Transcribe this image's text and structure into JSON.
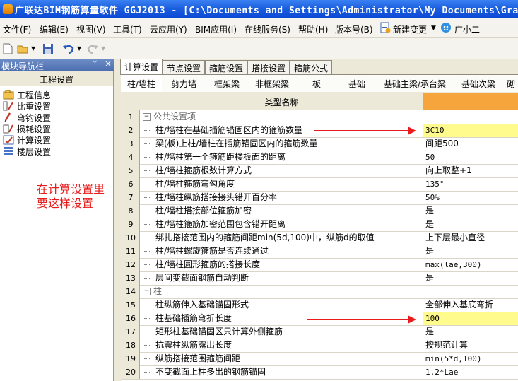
{
  "window": {
    "title": "广联达BIM钢筋算量软件 GGJ2013 - [C:\\Documents and Settings\\Administrator\\My Documents\\GrandS"
  },
  "menu": [
    {
      "label": "文件(F)"
    },
    {
      "label": "编辑(E)"
    },
    {
      "label": "视图(V)"
    },
    {
      "label": "工具(T)"
    },
    {
      "label": "云应用(Y)"
    },
    {
      "label": "BIM应用(I)"
    },
    {
      "label": "在线服务(S)"
    },
    {
      "label": "帮助(H)"
    },
    {
      "label": "版本号(B)"
    },
    {
      "label": "新建变更"
    },
    {
      "label": "广小二"
    }
  ],
  "nav": {
    "title": "模块导航栏",
    "section": "工程设置",
    "items": [
      {
        "label": "工程信息"
      },
      {
        "label": "比重设置"
      },
      {
        "label": "弯钩设置"
      },
      {
        "label": "损耗设置"
      },
      {
        "label": "计算设置"
      },
      {
        "label": "楼层设置"
      }
    ]
  },
  "annotation": {
    "line1": "在计算设置里",
    "line2": "要这样设置"
  },
  "tabs": [
    {
      "label": "计算设置"
    },
    {
      "label": "节点设置"
    },
    {
      "label": "箍筋设置"
    },
    {
      "label": "搭接设置"
    },
    {
      "label": "箍筋公式"
    }
  ],
  "subtabs": [
    {
      "label": "柱/墙柱"
    },
    {
      "label": "剪力墙"
    },
    {
      "label": "框架梁"
    },
    {
      "label": "非框架梁"
    },
    {
      "label": "板"
    },
    {
      "label": "基础"
    },
    {
      "label": "基础主梁/承台梁"
    },
    {
      "label": "基础次梁"
    },
    {
      "label": "砌"
    }
  ],
  "grid": {
    "header_name": "类型名称",
    "rows": [
      {
        "num": "1",
        "name": "公共设置项",
        "value": "",
        "group": true
      },
      {
        "num": "2",
        "name": "柱/墙柱在基础插筋锚固区内的箍筋数量",
        "value": "3C10",
        "highlight": true
      },
      {
        "num": "3",
        "name": "梁(板)上柱/墙柱在插筋锚固区内的箍筋数量",
        "value": "间距500"
      },
      {
        "num": "4",
        "name": "柱/墙柱第一个箍筋距楼板面的距离",
        "value": "50"
      },
      {
        "num": "5",
        "name": "柱/墙柱箍筋根数计算方式",
        "value": "向上取整+1"
      },
      {
        "num": "6",
        "name": "柱/墙柱箍筋弯勾角度",
        "value": "135°"
      },
      {
        "num": "7",
        "name": "柱/墙柱纵筋搭接接头错开百分率",
        "value": "50%"
      },
      {
        "num": "8",
        "name": "柱/墙柱搭接部位箍筋加密",
        "value": "是"
      },
      {
        "num": "9",
        "name": "柱/墙柱箍筋加密范围包含错开距离",
        "value": "是"
      },
      {
        "num": "10",
        "name": "绑扎搭接范围内的箍筋间距min(5d,100)中，纵筋d的取值",
        "value": "上下层最小直径"
      },
      {
        "num": "11",
        "name": "柱/墙柱螺旋箍筋是否连续通过",
        "value": "是"
      },
      {
        "num": "12",
        "name": "柱/墙柱圆形箍筋的搭接长度",
        "value": "max(lae,300)"
      },
      {
        "num": "13",
        "name": "层间变截面钢筋自动判断",
        "value": "是"
      },
      {
        "num": "14",
        "name": "柱",
        "value": "",
        "group": true
      },
      {
        "num": "15",
        "name": "柱纵筋伸入基础锚固形式",
        "value": "全部伸入基底弯折"
      },
      {
        "num": "16",
        "name": "柱基础插筋弯折长度",
        "value": "100",
        "highlight": true
      },
      {
        "num": "17",
        "name": "矩形柱基础锚固区只计算外侧箍筋",
        "value": "是"
      },
      {
        "num": "18",
        "name": "抗震柱纵筋露出长度",
        "value": "按规范计算"
      },
      {
        "num": "19",
        "name": "纵筋搭接范围箍筋间距",
        "value": "min(5*d,100)"
      },
      {
        "num": "20",
        "name": "不变截面上柱多出的钢筋锚固",
        "value": "1.2*Lae"
      }
    ]
  }
}
